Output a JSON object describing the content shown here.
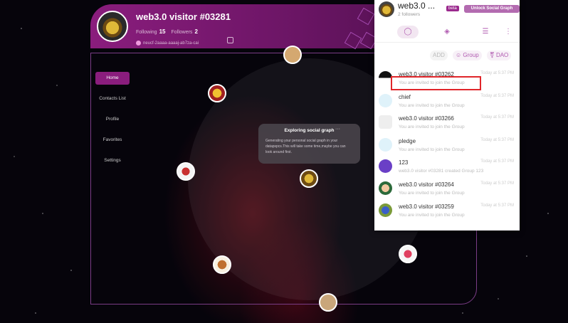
{
  "profile": {
    "name": "web3.0 visitor #03281",
    "following_label": "Following",
    "following_count": "15",
    "followers_label": "Followers",
    "followers_count": "2",
    "address": "neucf-2aaaa-aaaaj-ab7za-cai"
  },
  "sidebar": {
    "items": [
      {
        "label": "Home"
      },
      {
        "label": "Contacts List"
      },
      {
        "label": "Profile"
      },
      {
        "label": "Favorites"
      },
      {
        "label": "Settings"
      }
    ]
  },
  "exploring": {
    "title": "Exploring social graph",
    "dots": "···",
    "text": "Generating your personal social graph in your datapspcs.This will take some time,maybe you can look around first."
  },
  "popup": {
    "name": "web3.0 ...",
    "followers": "2 followers",
    "beta": "beta",
    "unlock": "Unlock Social Graph",
    "actions": {
      "add": "ADD",
      "group": "Group",
      "dao": "DAO"
    },
    "messages": [
      {
        "title": "web3.0 visitor #03262",
        "time": "Today at 5:37 PM",
        "sub": "You are invited to join the Group"
      },
      {
        "title": "chief",
        "time": "Today at 5:37 PM",
        "sub": "You are invited to join the Group"
      },
      {
        "title": "web3.0 visitor #03266",
        "time": "Today at 5:37 PM",
        "sub": "You are invited to join the Group"
      },
      {
        "title": "pledge",
        "time": "Today at 5:37 PM",
        "sub": "You are invited to join the Group"
      },
      {
        "title": "123",
        "time": "Today at 5:37 PM",
        "sub": "web3.0 visitor #03281 created Group 123"
      },
      {
        "title": "web3.0 visitor #03264",
        "time": "Today at 5:37 PM",
        "sub": "You are invited to join the Group"
      },
      {
        "title": "web3.0 visitor #03259",
        "time": "Today at 5:37 PM",
        "sub": "You are invited to join the Group"
      }
    ]
  },
  "colors": {
    "accent": "#8a1d7d",
    "highlight": "#e0262a"
  }
}
